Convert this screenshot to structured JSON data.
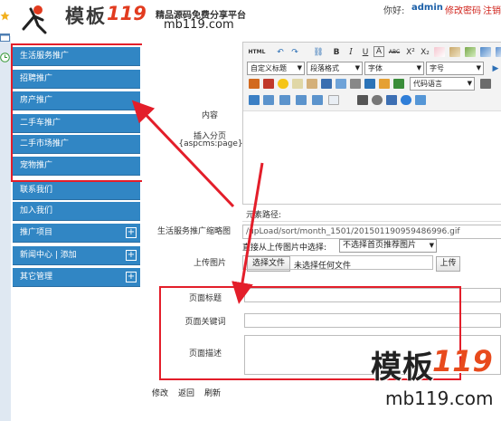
{
  "header": {
    "logo_text": "模板",
    "logo_num": "119",
    "slogan": "精品源码免费分享平台",
    "url": "mb119.com",
    "hello": "你好:",
    "user": "admin",
    "change_password": "修改密码",
    "logout": "注销"
  },
  "sidebar": {
    "items": [
      {
        "label": "生活服务推广"
      },
      {
        "label": "招聘推广"
      },
      {
        "label": "房产推广"
      },
      {
        "label": "二手车推广"
      },
      {
        "label": "二手市场推广"
      },
      {
        "label": "宠物推广"
      },
      {
        "label": "联系我们"
      },
      {
        "label": "加入我们"
      },
      {
        "label": "推广项目"
      },
      {
        "label": "新闻中心 |  添加"
      },
      {
        "label": "其它管理"
      }
    ]
  },
  "form": {
    "content_label": "内容",
    "insert_page_label": "插入分页",
    "insert_page_code": "{aspcms:page}",
    "path_label": "元素路径:",
    "thumb_label": "生活服务推广缩略图",
    "thumb_value": "/upLoad/sort/month_1501/201501190959486996.gif",
    "choose_from_label": "直接从上传图片中选择:",
    "choose_select": "不选择首页推荐图片",
    "upload_label": "上传图片",
    "choose_file_btn": "选择文件",
    "no_file": "未选择任何文件",
    "upload_btn": "上传",
    "page_title_label": "页面标题",
    "keywords_label": "页面关键词",
    "desc_label": "页面描述",
    "buttons": {
      "edit": "修改",
      "back": "返回",
      "refresh": "刷新"
    }
  },
  "editor": {
    "html_btn": "HTML",
    "select_title": "自定义标题",
    "select_para": "段落格式",
    "select_font": "字体",
    "select_size": "字号",
    "select_code": "代码语言",
    "bold": "B",
    "italic": "I",
    "underline": "U",
    "a_btn": "A",
    "abc": "ABC",
    "sup": "X²",
    "sub": "X₂"
  },
  "watermark": {
    "cn": "模板",
    "num": "119",
    "url": "mb119.com"
  },
  "colors": {
    "nav": "#3186c4",
    "highlight": "#e31e2a",
    "link_red": "#d0231b",
    "link_blue": "#1a5fa8"
  }
}
